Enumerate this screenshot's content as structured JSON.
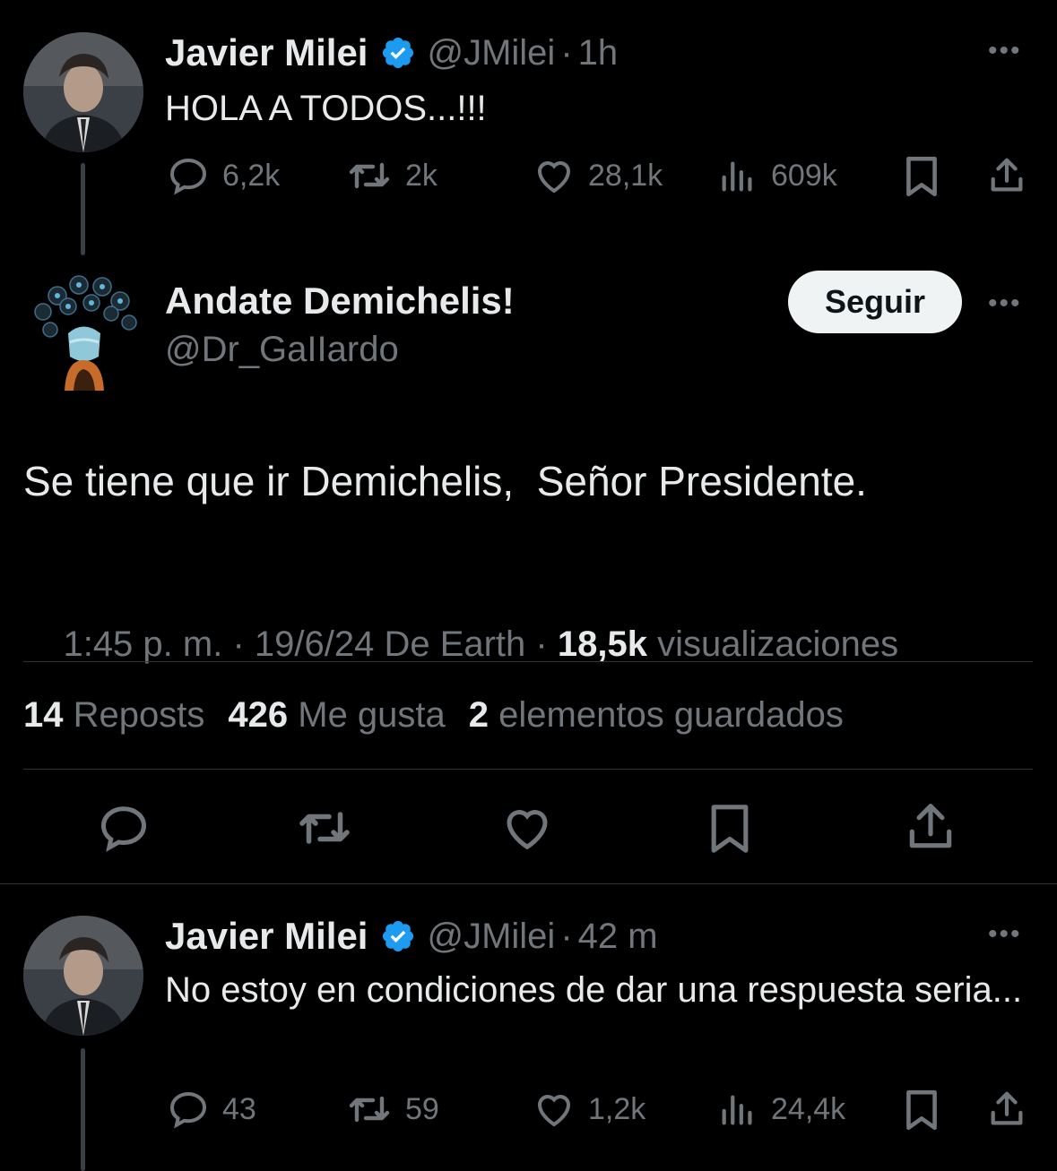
{
  "tweet1": {
    "name": "Javier Milei",
    "handle": "@JMilei",
    "sep": "·",
    "time": "1h",
    "text": "HOLA A TODOS...!!!",
    "replies": "6,2k",
    "reposts": "2k",
    "likes": "28,1k",
    "views": "609k"
  },
  "main": {
    "name": "Andate Demichelis!",
    "handle": "@Dr_GaIIardo",
    "follow_label": "Seguir",
    "text": "Se tiene que ir Demichelis,  Señor Presidente.",
    "meta_time": "1:45 p. m. · 19/6/24 De Earth · ",
    "views_count": "18,5k",
    "views_label": " visualizaciones",
    "stats": {
      "reposts_count": "14",
      "reposts_label": "Reposts",
      "likes_count": "426",
      "likes_label": "Me gusta",
      "saved_count": "2",
      "saved_label": "elementos guardados"
    }
  },
  "tweet3": {
    "name": "Javier Milei",
    "handle": "@JMilei",
    "sep": "·",
    "time": "42 m",
    "text": "No estoy en condiciones de dar una respuesta seria...",
    "replies": "43",
    "reposts": "59",
    "likes": "1,2k",
    "views": "24,4k"
  },
  "more_label": "•••",
  "colors": {
    "verified": "#1d9bf0",
    "muted": "#71767b",
    "text": "#e7e9ea",
    "bg": "#000000"
  }
}
